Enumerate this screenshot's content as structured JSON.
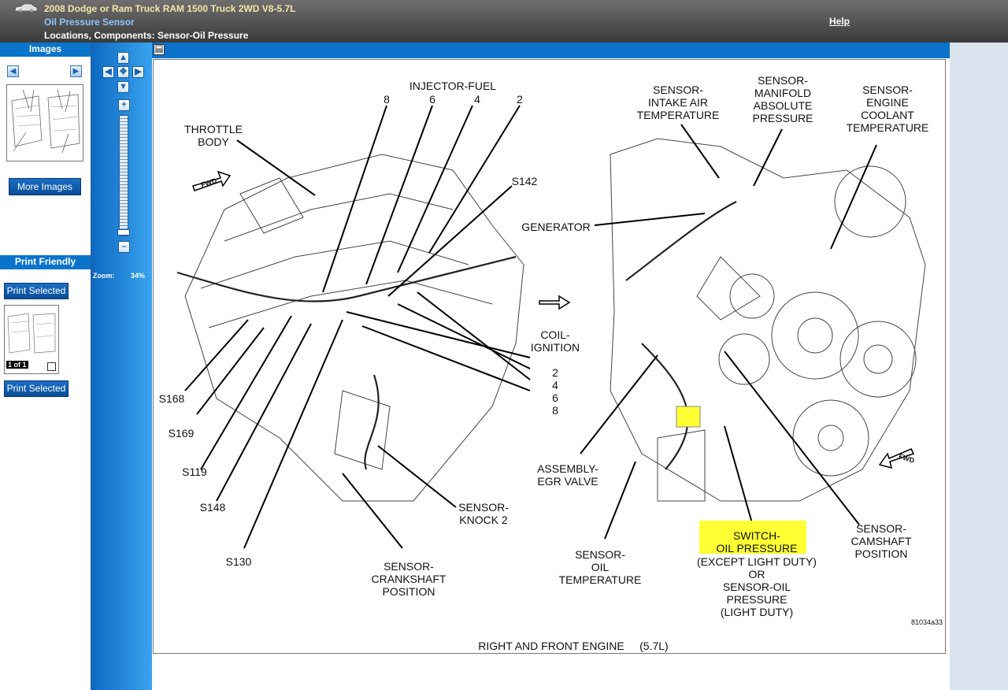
{
  "header": {
    "vehicle": "2008 Dodge or Ram Truck RAM 1500 Truck 2WD V8-5.7L",
    "topic": "Oil Pressure Sensor",
    "path": "Locations, Components: Sensor-Oil Pressure",
    "help": "Help"
  },
  "left_panel": {
    "images_title": "Images",
    "more_images": "More Images",
    "print_title": "Print Friendly",
    "print_selected_1": "Print Selected",
    "page_badge": "1 of 1",
    "print_selected_2": "Print Selected"
  },
  "zoom": {
    "label": "Zoom:",
    "value": "34%"
  },
  "diagram": {
    "injector": "INJECTOR-FUEL",
    "inj_nums": [
      "8",
      "6",
      "4",
      "2"
    ],
    "throttle": "THROTTLE\nBODY",
    "fwd": "FWD",
    "s142": "S142",
    "generator": "GENERATOR",
    "iat": "SENSOR-\nINTAKE AIR\nTEMPERATURE",
    "map": "SENSOR-\nMANIFOLD\nABSOLUTE\nPRESSURE",
    "ect": "SENSOR-\nENGINE\nCOOLANT\nTEMPERATURE",
    "coil": "COIL-\nIGNITION",
    "coil_nums": "2\n4\n6\n8",
    "s168": "S168",
    "s169": "S169",
    "s119": "S119",
    "s148": "S148",
    "s130": "S130",
    "knock": "SENSOR-\nKNOCK 2",
    "ckp": "SENSOR-\nCRANKSHAFT\nPOSITION",
    "egr": "ASSEMBLY-\nEGR VALVE",
    "oil_temp": "SENSOR-\nOIL\nTEMPERATURE",
    "switch": "SWITCH-\nOIL PRESSURE",
    "switch_sub": "(EXCEPT LIGHT DUTY)\nOR\nSENSOR-OIL\nPRESSURE\n(LIGHT DUTY)",
    "cmp": "SENSOR-\nCAMSHAFT\nPOSITION",
    "code": "81034a33",
    "caption": "RIGHT AND FRONT ENGINE     (5.7L)",
    "highlight": "#ffff33"
  }
}
